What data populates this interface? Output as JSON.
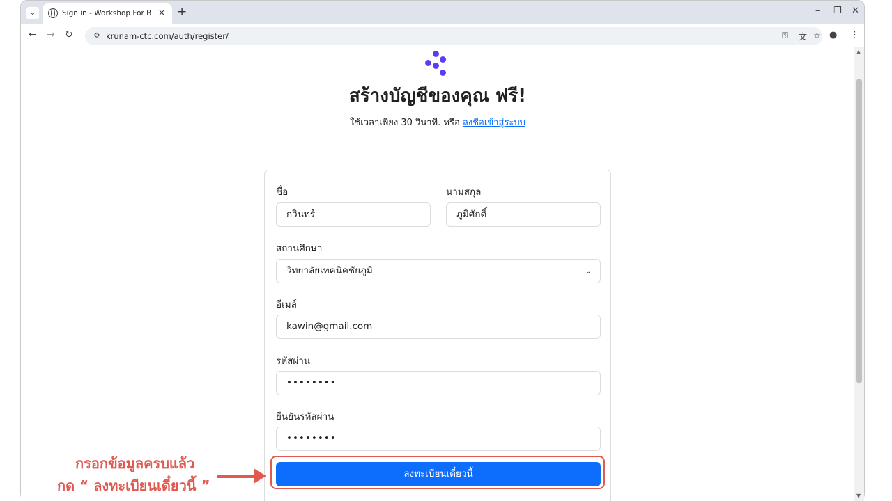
{
  "browser": {
    "tab_title": "Sign in - Workshop For Beginners",
    "tab_close": "×",
    "new_tab": "+",
    "url": "krunam-ctc.com/auth/register/",
    "minimize": "–",
    "restore": "❐",
    "close": "✕"
  },
  "page": {
    "title": "สร้างบัญชีของคุณ ฟรี!",
    "subtitle_text": "ใช้เวลาเพียง 30 วินาที. หรือ ",
    "subtitle_link": "ลงชื่อเข้าสู่ระบบ"
  },
  "form": {
    "first_name_label": "ชื่อ",
    "first_name_value": "กวินทร์",
    "last_name_label": "นามสกุล",
    "last_name_value": "ภูมิศักดิ์",
    "school_label": "สถานศึกษา",
    "school_value": "วิทยาลัยเทคนิคชัยภูมิ",
    "email_label": "อีเมล์",
    "email_value": "kawin@gmail.com",
    "password_label": "รหัสผ่าน",
    "password_value": "••••••••",
    "confirm_label": "ยืนยันรหัสผ่าน",
    "confirm_value": "••••••••",
    "submit_label": "ลงทะเบียนเดี๋ยวนี้"
  },
  "annotation": {
    "line1": "กรอกข้อมูลครบแล้ว",
    "line2": "กด “ ลงทะเบียนเดี๋ยวนี้ ”",
    "color": "#e05a52"
  },
  "colors": {
    "primary": "#0d6efd",
    "logo": "#5b3df5"
  }
}
